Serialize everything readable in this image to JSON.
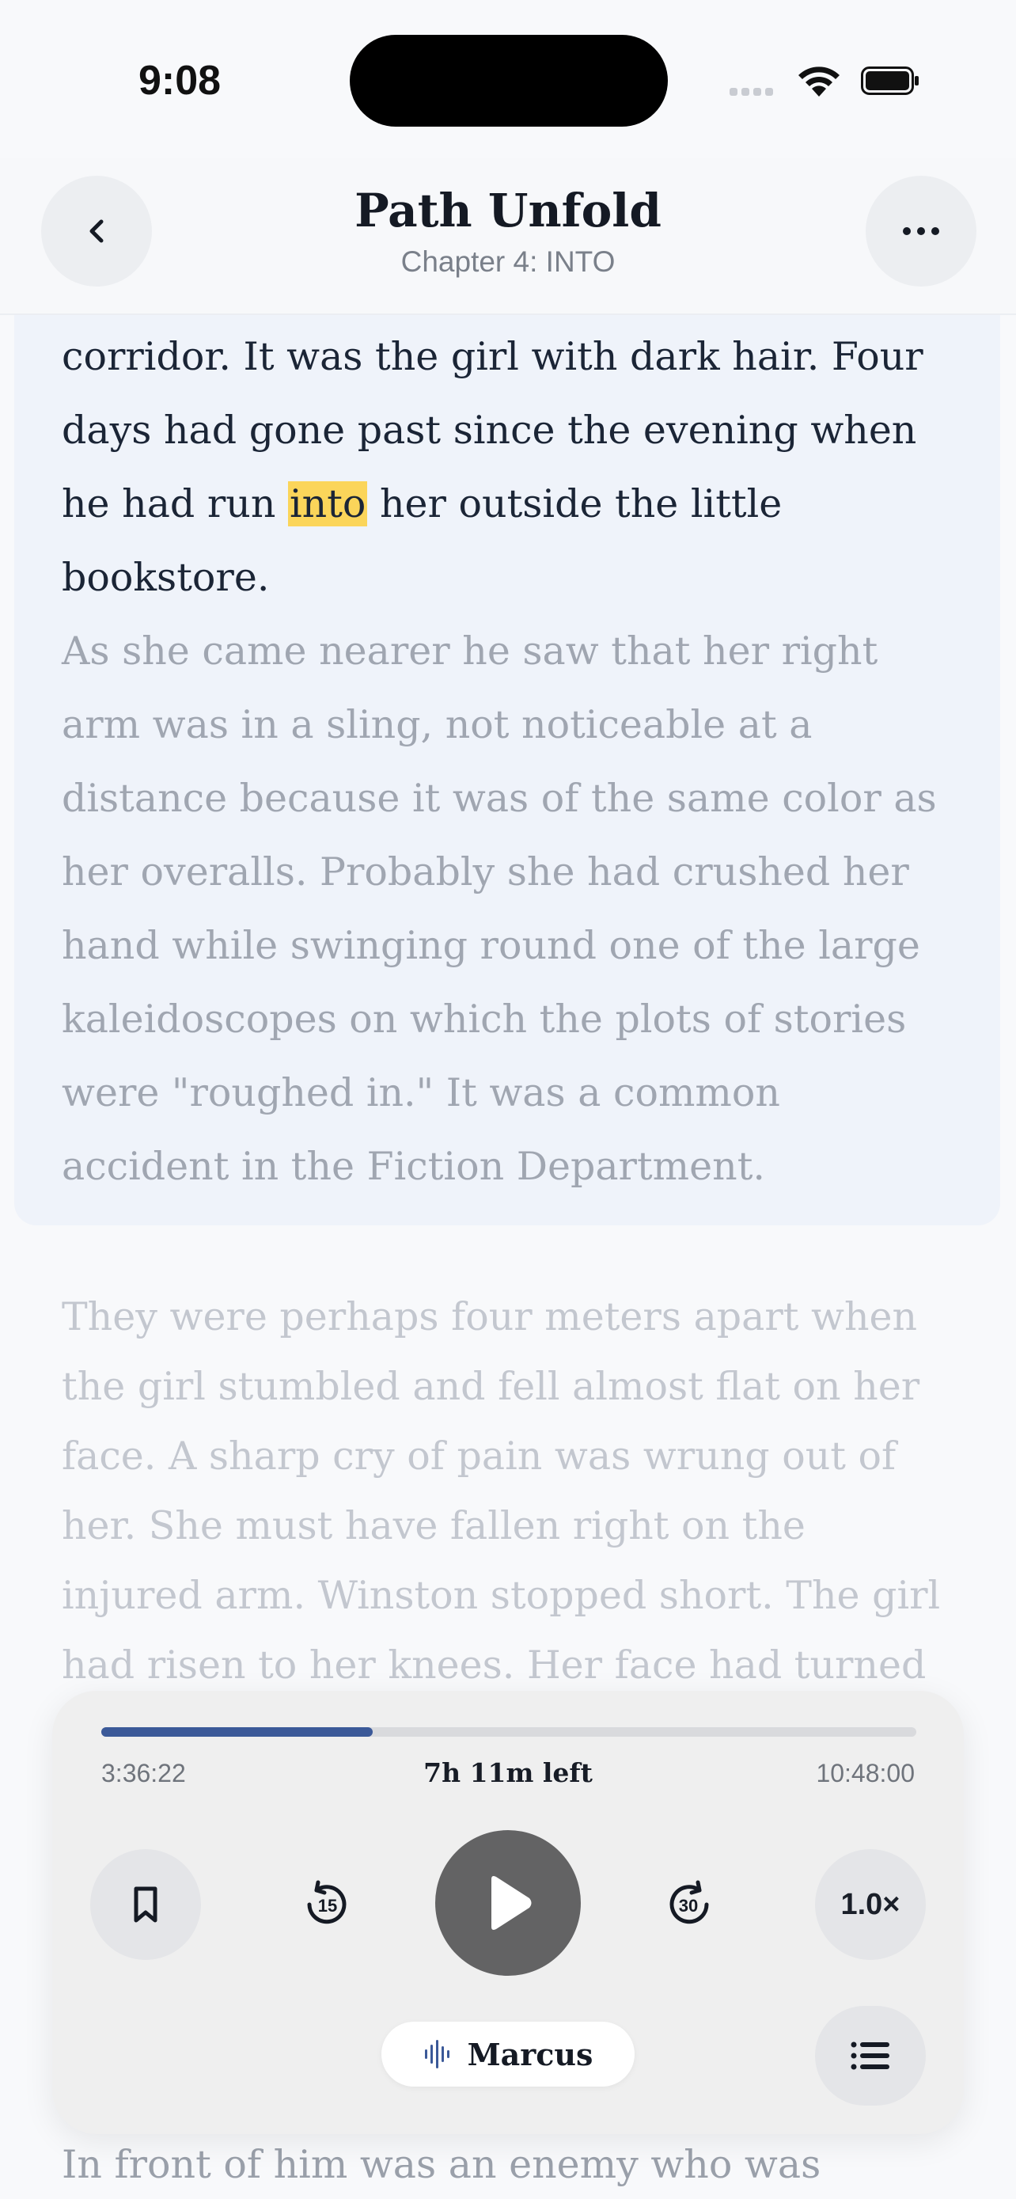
{
  "status_bar": {
    "time": "9:08"
  },
  "header": {
    "title": "Path Unfold",
    "chapter": "Chapter 4: INTO"
  },
  "content": {
    "p1_before": "corridor. It was the girl with dark hair. Four days had gone past since the evening when he had run ",
    "p1_highlight": "into",
    "p1_after": " her outside the little bookstore.",
    "p2": "As she came nearer he saw that her right arm was in a sling, not noticeable at a distance because it was of the same color as her overalls. Probably she had crushed her hand while swinging round one of the large kaleidoscopes on which the plots of stories were \"roughed in.\" It was a common accident in the Fiction Department.",
    "p3": "They were perhaps four meters apart when the girl stumbled and fell almost flat on her face. A sharp cry of pain was wrung out of her. She must have fallen right on the injured arm. Winston stopped short. The girl had risen to her knees. Her face had turned",
    "p4": "In front of him was an enemy who was"
  },
  "player": {
    "elapsed": "3:36:22",
    "remaining": "7h 11m left",
    "total": "10:48:00",
    "progress": 0.333,
    "skip_back": "15",
    "skip_forward": "30",
    "speed": "1.0×",
    "voice": "Marcus"
  },
  "colors": {
    "accent": "#3b5998",
    "highlight": "#fbd55a",
    "active_block": "#eff3fa"
  }
}
